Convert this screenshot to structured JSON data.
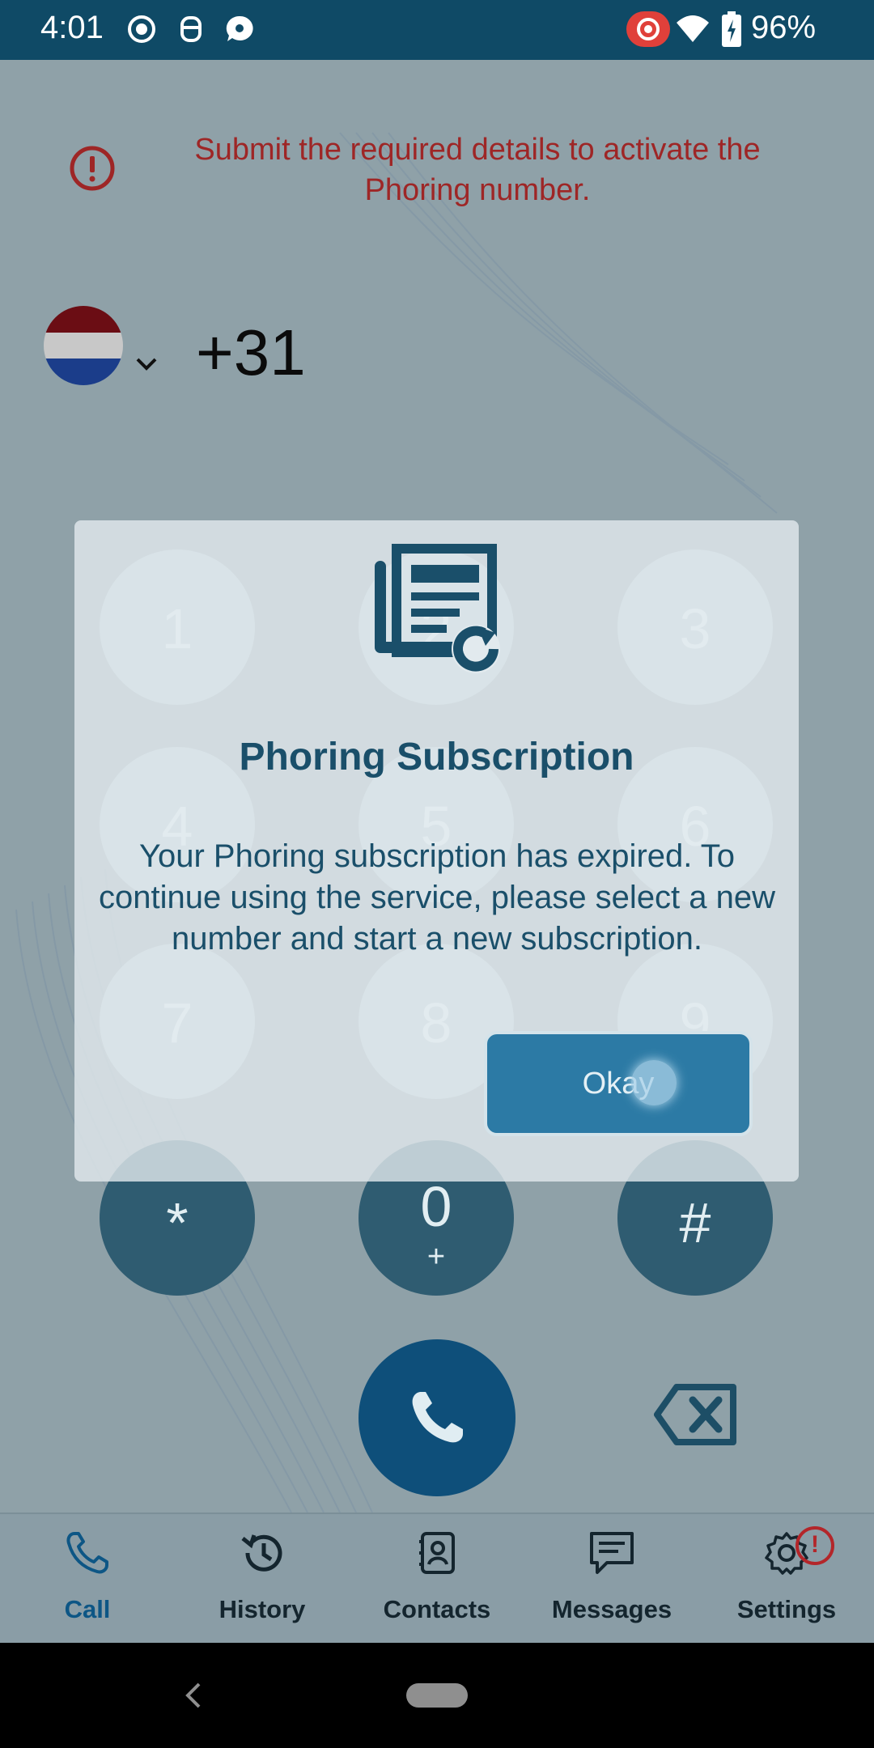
{
  "status_bar": {
    "time": "4:01",
    "battery": "96%",
    "icons": [
      "record-icon",
      "face-icon",
      "chat-bubble-icon",
      "screen-record-icon",
      "wifi-icon",
      "battery-icon"
    ]
  },
  "banner": {
    "text": "Submit the required details to activate the Phoring number.",
    "icon": "alert-circle-icon",
    "color": "#9e2626"
  },
  "dialer": {
    "country_code": "+31",
    "country_flag": "netherlands-flag",
    "keys": [
      {
        "digit": "1"
      },
      {
        "digit": "2"
      },
      {
        "digit": "3"
      },
      {
        "digit": "4"
      },
      {
        "digit": "5"
      },
      {
        "digit": "6"
      },
      {
        "digit": "7"
      },
      {
        "digit": "8"
      },
      {
        "digit": "9"
      },
      {
        "digit": "*"
      },
      {
        "digit": "0",
        "sub": "+"
      },
      {
        "digit": "#"
      }
    ]
  },
  "dialog": {
    "title": "Phoring Subscription",
    "message": "Your Phoring subscription has expired. To continue using the service, please select a new number and start a new subscription.",
    "button_label": "Okay",
    "icon": "newspaper-refresh-icon"
  },
  "bottom_nav": {
    "items": [
      {
        "label": "Call",
        "icon": "phone-icon",
        "active": true
      },
      {
        "label": "History",
        "icon": "history-icon"
      },
      {
        "label": "Contacts",
        "icon": "contacts-icon"
      },
      {
        "label": "Messages",
        "icon": "messages-icon"
      },
      {
        "label": "Settings",
        "icon": "gear-icon",
        "badge": "!"
      }
    ]
  },
  "colors": {
    "primary": "#0e4f7a",
    "status_bar": "#0f4a66",
    "alert": "#9e2626",
    "button": "#2c7aa5"
  }
}
